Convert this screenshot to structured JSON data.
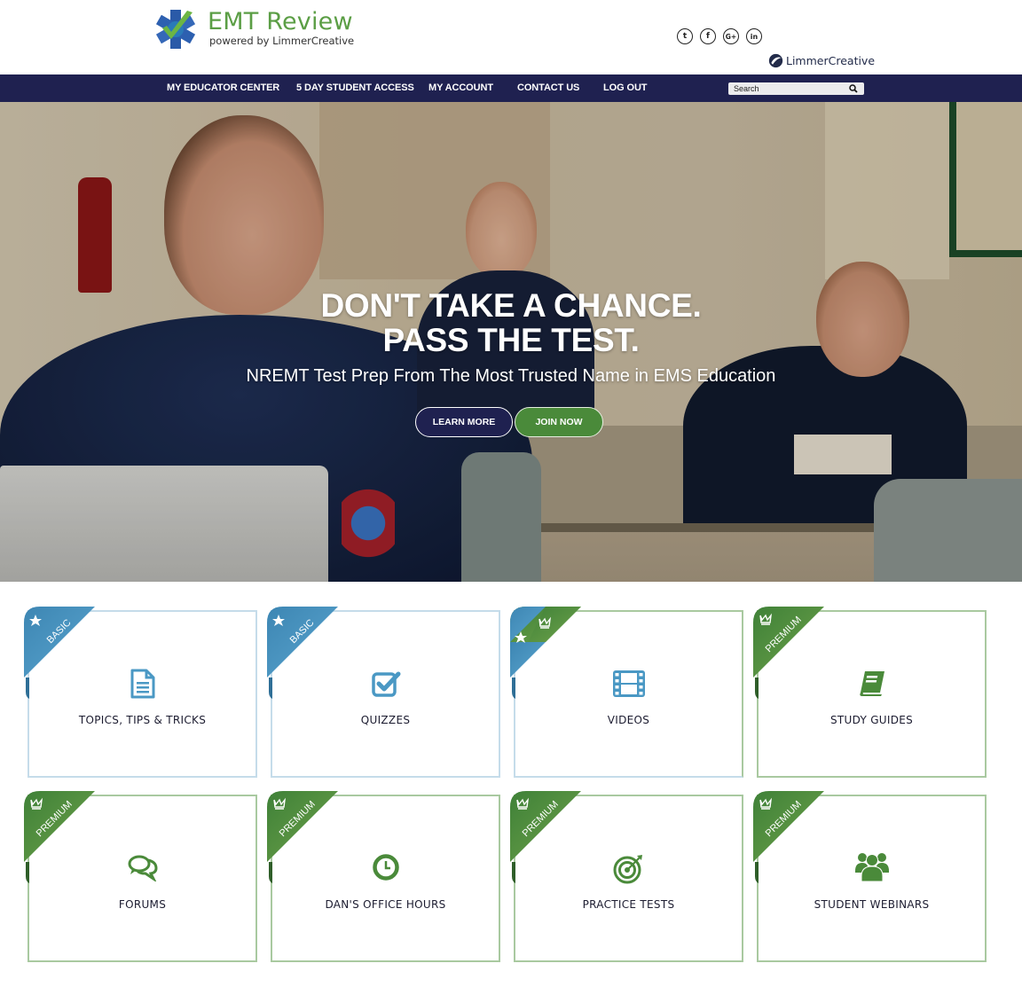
{
  "header": {
    "logo_title": "EMT Review",
    "logo_subtitle": "powered by LimmerCreative",
    "social": [
      {
        "icon": "twitter-icon",
        "glyph": "t"
      },
      {
        "icon": "facebook-icon",
        "glyph": "f"
      },
      {
        "icon": "google-plus-icon",
        "glyph": "G+"
      },
      {
        "icon": "linkedin-icon",
        "glyph": "in"
      }
    ],
    "partner_brand": "LimmerCreative"
  },
  "nav": {
    "items": [
      {
        "label": "MY EDUCATOR CENTER"
      },
      {
        "label": "5 DAY STUDENT ACCESS"
      },
      {
        "label": "MY ACCOUNT"
      },
      {
        "label": "CONTACT US"
      },
      {
        "label": "LOG OUT"
      }
    ],
    "search_placeholder": "Search"
  },
  "hero": {
    "headline_line1": "DON'T TAKE A CHANCE.",
    "headline_line2": "PASS THE TEST.",
    "subheadline": "NREMT Test Prep From The Most Trusted Name in EMS Education",
    "learn_more_label": "LEARN MORE",
    "join_now_label": "JOIN NOW"
  },
  "colors": {
    "nav_bg": "#1f2150",
    "brand_green": "#5b9e45",
    "premium_green": "#4a8a3a",
    "basic_blue": "#4a98c4"
  },
  "cards": [
    {
      "label": "TOPICS, TIPS & TRICKS",
      "tier": "BASIC",
      "icon": "document-icon"
    },
    {
      "label": "QUIZZES",
      "tier": "BASIC",
      "icon": "checkbox-icon"
    },
    {
      "label": "VIDEOS",
      "tier": "BASIC + PREMIUM",
      "icon": "film-icon"
    },
    {
      "label": "STUDY GUIDES",
      "tier": "PREMIUM",
      "icon": "book-icon"
    },
    {
      "label": "FORUMS",
      "tier": "PREMIUM",
      "icon": "chat-bubbles-icon"
    },
    {
      "label": "DAN'S OFFICE HOURS",
      "tier": "PREMIUM",
      "icon": "clock-icon"
    },
    {
      "label": "PRACTICE TESTS",
      "tier": "PREMIUM",
      "icon": "target-icon"
    },
    {
      "label": "STUDENT WEBINARS",
      "tier": "PREMIUM",
      "icon": "users-group-icon"
    }
  ],
  "ribbon_labels": {
    "basic": "BASIC",
    "premium": "PREMIUM"
  }
}
